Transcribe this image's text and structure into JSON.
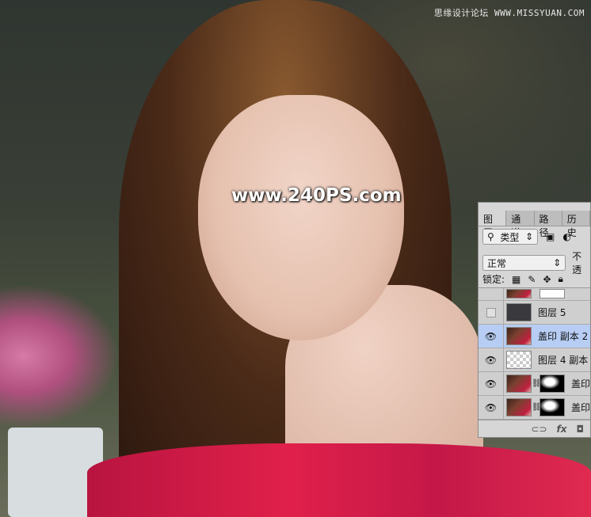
{
  "watermarks": {
    "top": "思缘设计论坛 WWW.MISSYUAN.COM",
    "center": "www.240PS.com"
  },
  "panel": {
    "tabs": [
      "图层",
      "通道",
      "路径",
      "历史"
    ],
    "filter_kind": "类型",
    "blend_mode": "正常",
    "opacity_label": "不透",
    "lock_label": "锁定:",
    "layers": [
      {
        "name": "",
        "visible": true,
        "thumb": "photo",
        "mask": true,
        "partial": true
      },
      {
        "name": "图层 5",
        "visible": false,
        "thumb": "dark"
      },
      {
        "name": "盖印 副本 2",
        "visible": true,
        "thumb": "photo",
        "selected": true
      },
      {
        "name": "图层 4 副本",
        "visible": true,
        "thumb": "checker"
      },
      {
        "name": "盖印",
        "visible": true,
        "thumb": "photo",
        "mask": true
      },
      {
        "name": "盖印",
        "visible": true,
        "thumb": "photo",
        "mask": true
      }
    ],
    "icons": [
      "search-icon",
      "image-filter-icon",
      "adjustment-filter-icon",
      "lock-pixels-icon",
      "lock-paint-icon",
      "lock-move-icon",
      "lock-all-icon",
      "link-icon",
      "fx-icon",
      "mask-icon"
    ]
  }
}
